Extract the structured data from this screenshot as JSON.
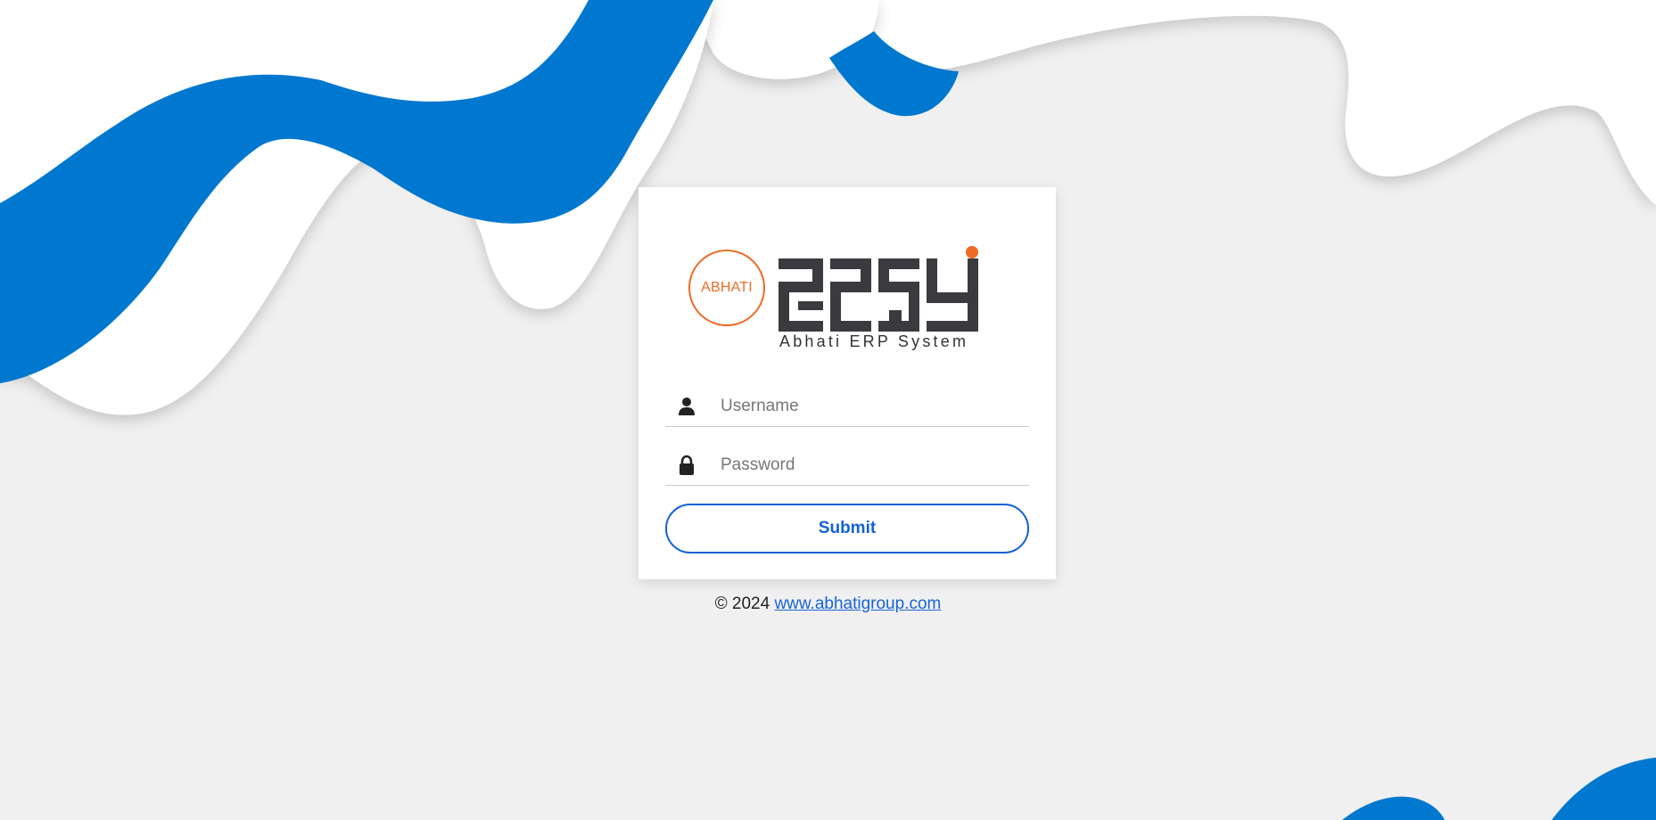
{
  "brand": {
    "circle_text": "ABHATI",
    "product_subtitle": "Abhati ERP System",
    "logo_mark_icon": "zesy-logo-icon"
  },
  "form": {
    "username_placeholder": "Username",
    "password_placeholder": "Password",
    "username_icon": "user-icon",
    "password_icon": "lock-icon",
    "submit_label": "Submit"
  },
  "footer": {
    "copyright": "© 2024",
    "link_text": "www.abhatigroup.com"
  },
  "colors": {
    "accent_blue": "#0078cf",
    "brand_orange": "#ee6b24",
    "button_blue": "#1361d4",
    "background": "#f0f0f0"
  }
}
